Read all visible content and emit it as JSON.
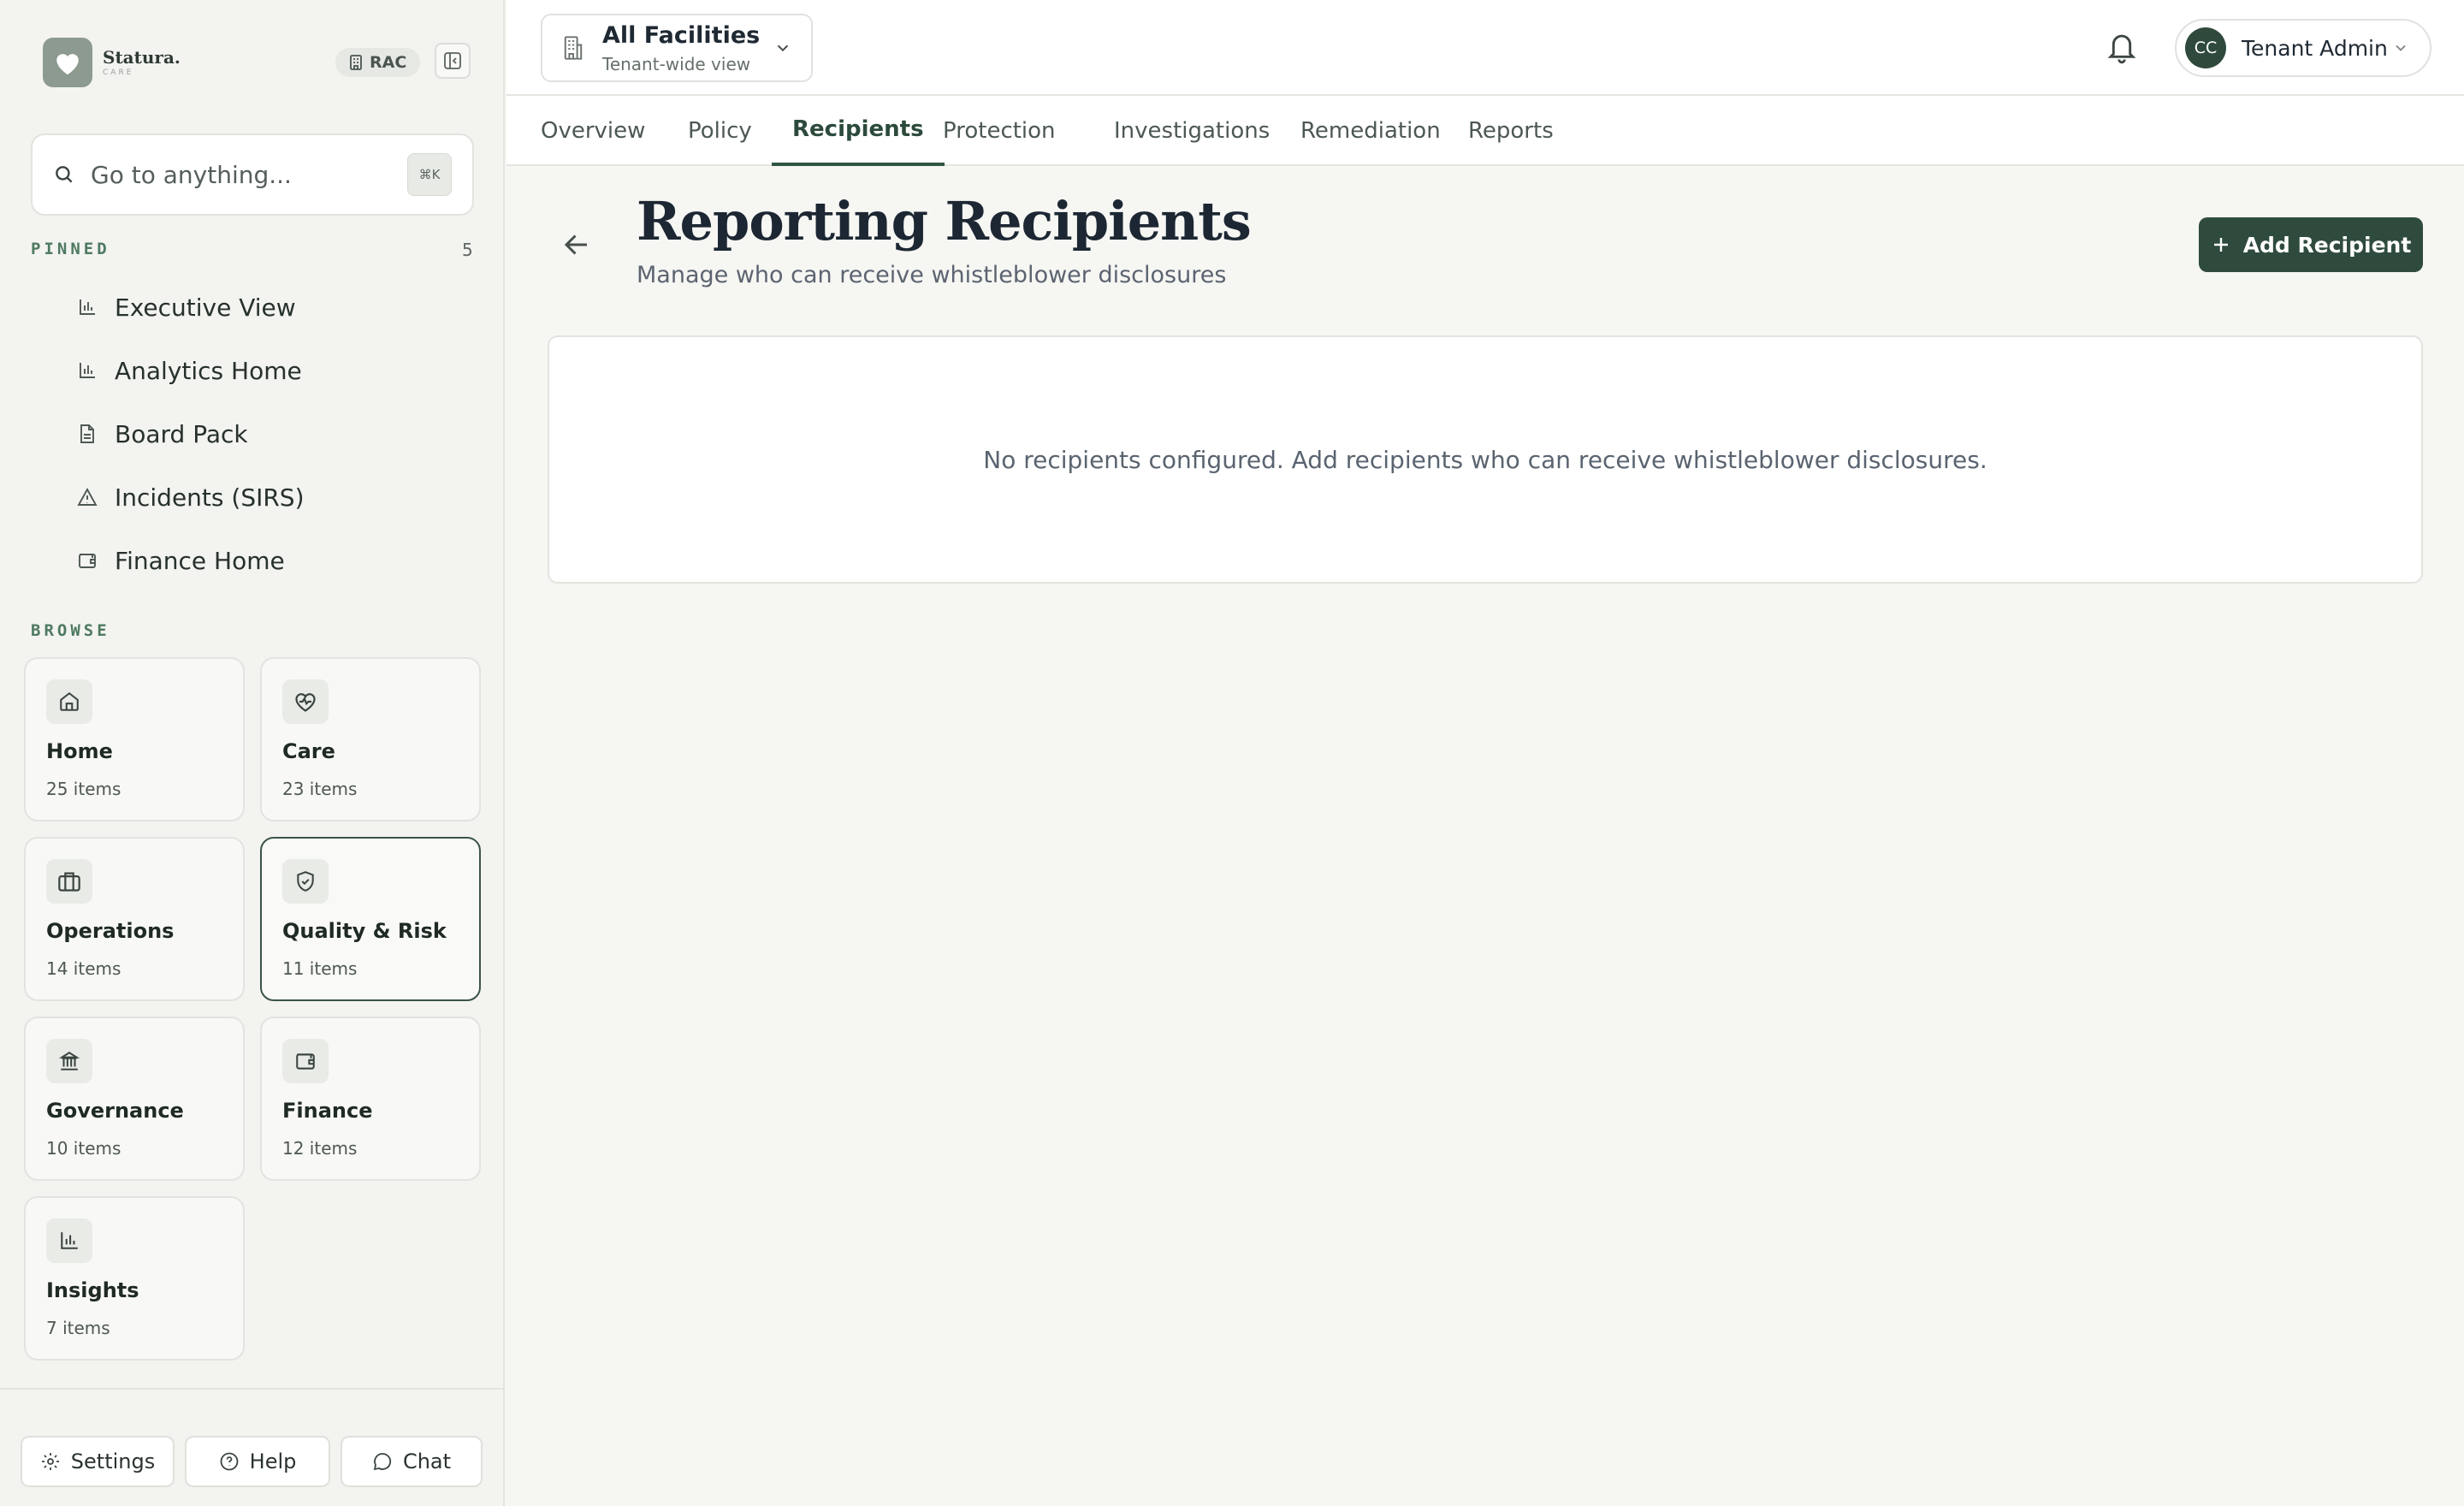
{
  "sidebar": {
    "brand": {
      "name": "Statura.",
      "sub": "CARE"
    },
    "tenant_badge": "RAC",
    "search": {
      "placeholder": "Go to anything...",
      "shortcut": "⌘K"
    },
    "pinned": {
      "label": "PINNED",
      "count": "5",
      "items": [
        {
          "label": "Executive View",
          "icon": "bar-chart-icon"
        },
        {
          "label": "Analytics Home",
          "icon": "bar-chart-icon"
        },
        {
          "label": "Board Pack",
          "icon": "document-icon"
        },
        {
          "label": "Incidents (SIRS)",
          "icon": "warning-icon"
        },
        {
          "label": "Finance Home",
          "icon": "wallet-icon"
        }
      ]
    },
    "browse": {
      "label": "BROWSE",
      "tiles": [
        {
          "title": "Home",
          "count": "25 items",
          "icon": "home-icon"
        },
        {
          "title": "Care",
          "count": "23 items",
          "icon": "heart-pulse-icon"
        },
        {
          "title": "Operations",
          "count": "14 items",
          "icon": "briefcase-icon"
        },
        {
          "title": "Quality & Risk",
          "count": "11 items",
          "icon": "shield-check-icon"
        },
        {
          "title": "Governance",
          "count": "10 items",
          "icon": "landmark-icon"
        },
        {
          "title": "Finance",
          "count": "12 items",
          "icon": "wallet-icon"
        },
        {
          "title": "Insights",
          "count": "7 items",
          "icon": "bar-chart-icon"
        }
      ]
    },
    "footer": {
      "settings": "Settings",
      "help": "Help",
      "chat": "Chat"
    }
  },
  "topbar": {
    "facility": {
      "title": "All Facilities",
      "subtitle": "Tenant-wide view"
    },
    "user": {
      "initials": "CC",
      "name": "Tenant Admin"
    }
  },
  "tabs": [
    "Overview",
    "Policy",
    "Recipients",
    "Protection",
    "Investigations",
    "Remediation",
    "Reports"
  ],
  "active_tab": "Recipients",
  "main": {
    "title": "Reporting Recipients",
    "subtitle": "Manage who can receive whistleblower disclosures",
    "add_button": "Add Recipient",
    "empty_message": "No recipients configured. Add recipients who can receive whistleblower disclosures."
  },
  "colors": {
    "accent": "#2f4b3d",
    "active_border": "#3b5447",
    "section_label": "#4e7a60"
  }
}
